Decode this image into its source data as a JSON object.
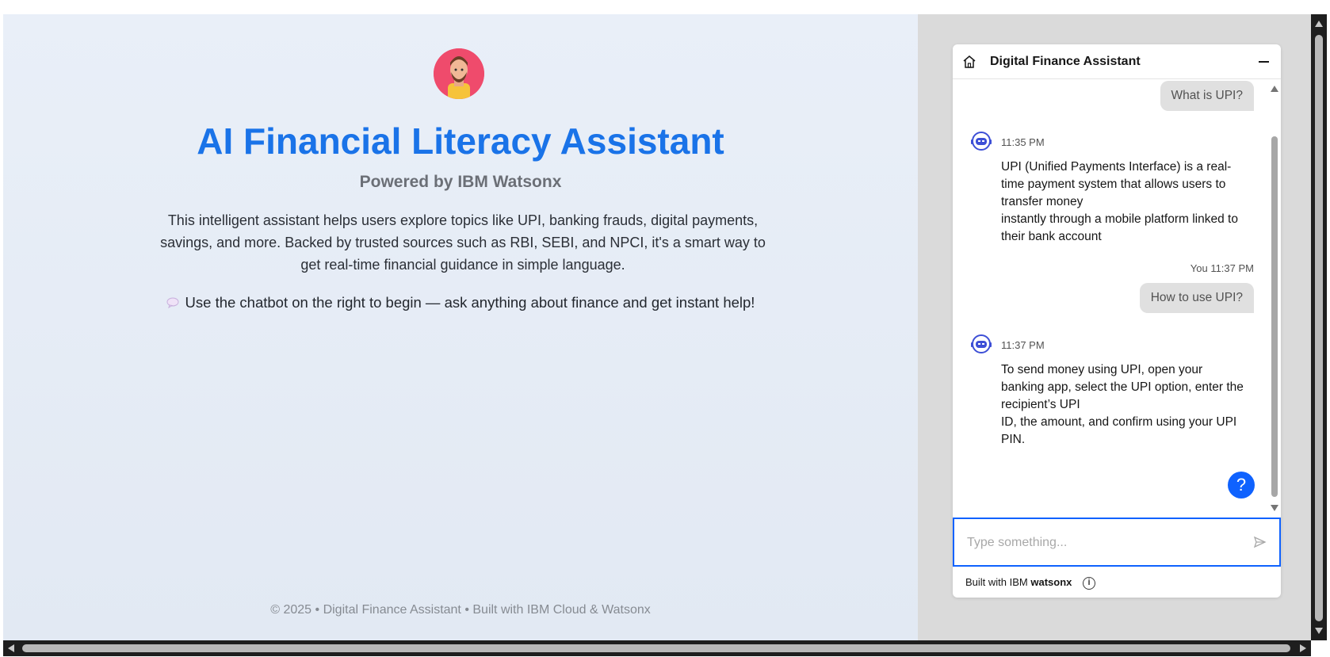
{
  "hero": {
    "title": "AI Financial Literacy Assistant",
    "subtitle": "Powered by IBM Watsonx",
    "description": "This intelligent assistant helps users explore topics like UPI, banking frauds, digital payments, savings, and more. Backed by trusted sources such as RBI, SEBI, and NPCI, it's a smart way to get real-time financial guidance in simple language.",
    "hint_icon": "speech-bubble-icon",
    "hint": "Use the chatbot on the right to begin — ask anything about finance and get instant help!",
    "footer": "© 2025 • Digital Finance Assistant • Built with IBM Cloud & Watsonx"
  },
  "chat": {
    "title": "Digital Finance Assistant",
    "messages": {
      "user1": "What is UPI?",
      "bot1_time": "11:35 PM",
      "bot1_text": "UPI (Unified Payments Interface) is a real-time payment system that allows users to transfer money\ninstantly through a mobile platform linked to their bank account",
      "user2_time": "You 11:37 PM",
      "user2": "How to use UPI?",
      "bot2_time": "11:37 PM",
      "bot2_text": "To send money using UPI, open your banking app, select the UPI option, enter the recipient’s UPI\nID, the amount, and confirm using your UPI PIN."
    },
    "help_label": "?",
    "input_placeholder": "Type something...",
    "built_prefix": "Built with IBM ",
    "built_brand": "watsonx",
    "info_label": "i"
  },
  "colors": {
    "accent": "#1a73e8",
    "button_blue": "#0f62fe"
  }
}
